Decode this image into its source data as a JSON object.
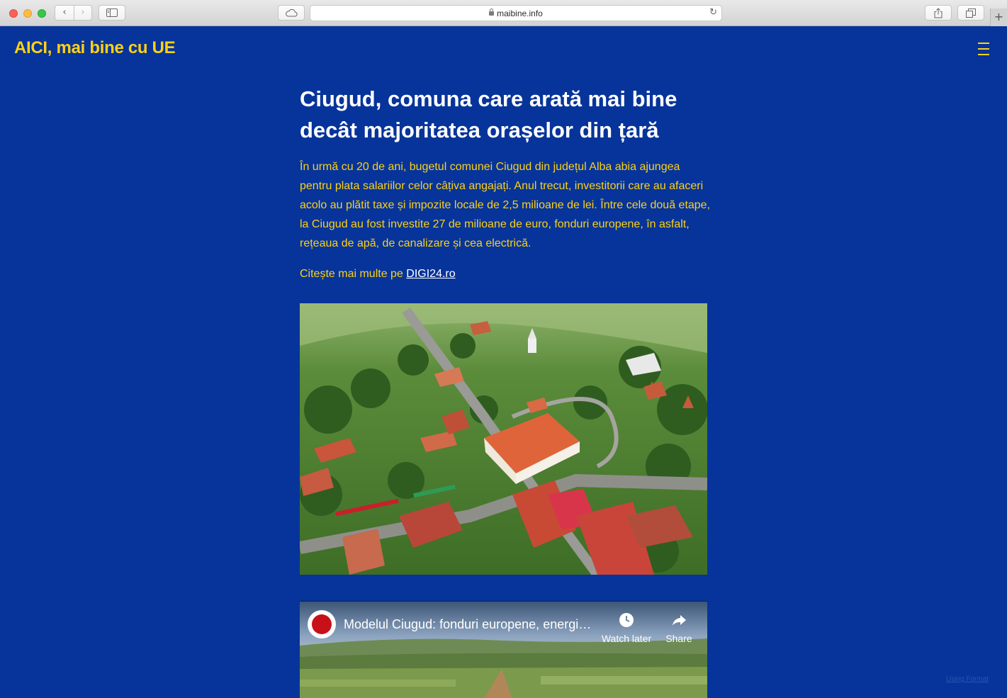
{
  "browser": {
    "url": "maibine.info"
  },
  "site": {
    "logo": "AICI, mai bine cu UE"
  },
  "article": {
    "title": "Ciugud, comuna care arată mai bine decât majoritatea orașelor din țară",
    "body": "În urmă cu 20 de ani, bugetul comunei Ciugud din județul Alba abia ajungea pentru plata salariilor celor câțiva angajați. Anul trecut, investitorii care au afaceri acolo au plătit taxe și impozite locale de 2,5 milioane de lei. Între cele două etape, la Ciugud au fost investite 27 de milioane de euro, fonduri europene, în asfalt, rețeaua de apă, de canalizare și cea electrică.",
    "more_prefix": "Citește mai multe pe ",
    "more_link": "DIGI24.ro"
  },
  "video": {
    "title": "Modelul Ciugud: fonduri europene, energie...",
    "watch_later": "Watch later",
    "share": "Share"
  },
  "footer": {
    "credit": "Using Format"
  },
  "colors": {
    "background": "#07349a",
    "accent": "#fcd116",
    "title": "#ffffff"
  },
  "icons": [
    "back-icon",
    "forward-icon",
    "sidebar-icon",
    "icloud-icon",
    "lock-icon",
    "reload-icon",
    "share-icon",
    "tabs-icon",
    "plus-icon",
    "menu-icon",
    "clock-icon",
    "share-arrow-icon"
  ]
}
